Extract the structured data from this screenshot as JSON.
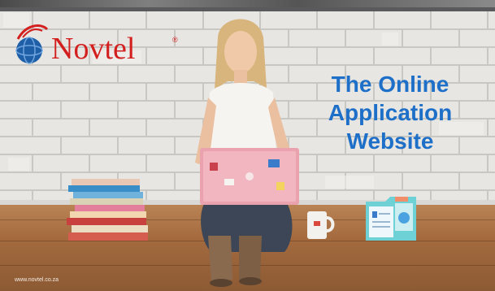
{
  "brand": {
    "name": "Novtel",
    "registered_mark": "®",
    "primary_color": "#d3201f",
    "globe_color": "#1e5fa8"
  },
  "headline": {
    "lines": [
      "The Online",
      "Application",
      "Website"
    ],
    "color": "#1d6fc8"
  },
  "footer": {
    "url": "www.novtel.co.za"
  },
  "icons": {
    "logo": "globe-icon",
    "document": "document-folder-icon",
    "mug": "mug-icon",
    "books": "book-stack-icon",
    "laptop": "laptop-icon"
  }
}
